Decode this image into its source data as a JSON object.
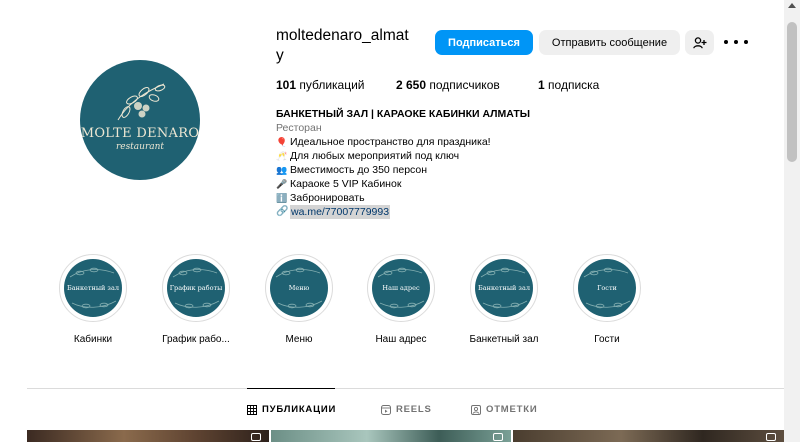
{
  "profile": {
    "username": "moltedenaro_almaty",
    "logo": {
      "main_text": "MOLTE DENARO",
      "sub_text": "restaurant"
    }
  },
  "actions": {
    "follow_label": "Подписаться",
    "message_label": "Отправить сообщение",
    "add_user_icon": "add-user-icon",
    "more_icon": "more-options-icon"
  },
  "stats": {
    "posts_count": "101",
    "posts_label": "публикаций",
    "followers_count": "2 650",
    "followers_label": "подписчиков",
    "following_count": "1",
    "following_label": "подписка"
  },
  "bio": {
    "name": "БАНКЕТНЫЙ ЗАЛ | КАРАОКЕ КАБИНКИ АЛМАТЫ",
    "category": "Ресторан",
    "lines": [
      {
        "emoji": "🎈",
        "text": "Идеальное пространство для праздника!"
      },
      {
        "emoji": "🥂",
        "text": "Для любых мероприятий под ключ"
      },
      {
        "emoji": "👥",
        "text": "Вместимость до 350 персон"
      },
      {
        "emoji": "🎤",
        "text": "Караоке 5 VIP Кабинок"
      },
      {
        "emoji": "ℹ️",
        "text": "Забронировать"
      }
    ],
    "link": "wa.me/77007779993"
  },
  "highlights": [
    {
      "cover_text": "Банкетный зал",
      "label": "Кабинки"
    },
    {
      "cover_text": "График работы",
      "label": "График рабо..."
    },
    {
      "cover_text": "Меню",
      "label": "Меню"
    },
    {
      "cover_text": "Наш адрес",
      "label": "Наш адрес"
    },
    {
      "cover_text": "Банкетный зал",
      "label": "Банкетный зал"
    },
    {
      "cover_text": "Гости",
      "label": "Гости"
    }
  ],
  "tabs": [
    {
      "label": "ПУБЛИКАЦИИ",
      "icon": "grid-icon",
      "active": true
    },
    {
      "label": "REELS",
      "icon": "reels-icon",
      "active": false
    },
    {
      "label": "ОТМЕТКИ",
      "icon": "tagged-icon",
      "active": false
    }
  ],
  "colors": {
    "accent": "#0095f6",
    "brand_teal": "#1f6172",
    "secondary_button": "#efefef",
    "muted_text": "#737373"
  }
}
